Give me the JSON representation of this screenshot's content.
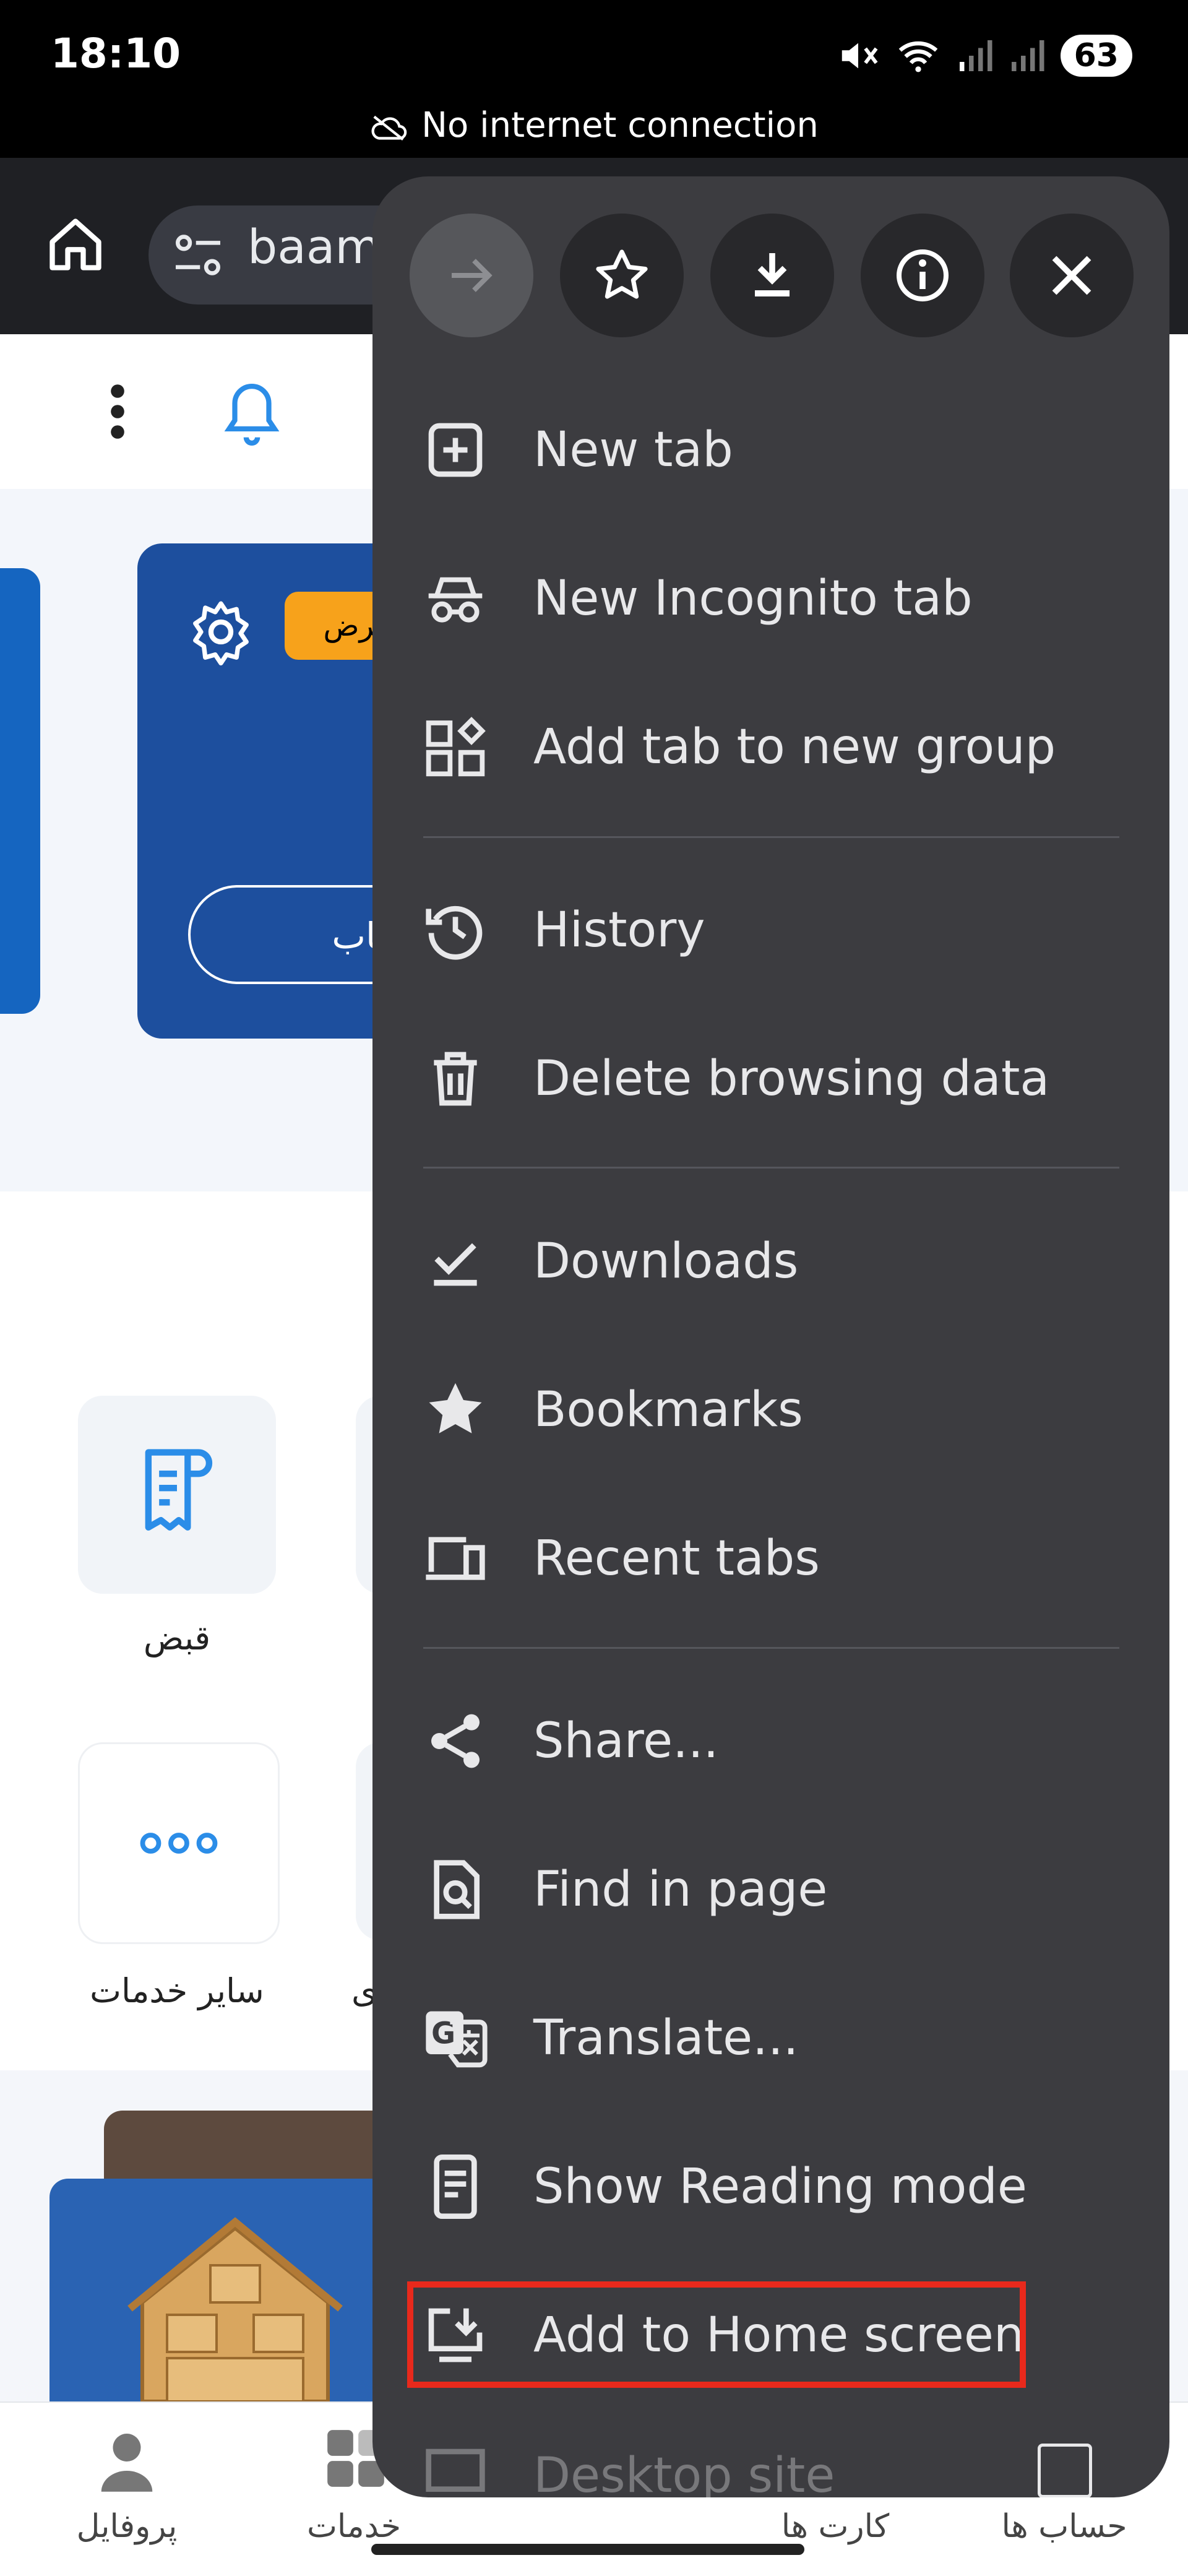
{
  "status_bar": {
    "time": "18:10",
    "battery": "63",
    "network_message": "No internet connection"
  },
  "browser": {
    "url_text": "baam",
    "toolbar_icons": [
      "forward-icon",
      "star-icon",
      "download-icon",
      "info-icon",
      "close-icon"
    ]
  },
  "page": {
    "card_badge": "فرض",
    "card_button": "ورتحساب",
    "services": [
      {
        "label": "قبض",
        "icon": "receipt-icon"
      },
      {
        "label": "سایر خدمات",
        "icon": "more-dots-icon"
      }
    ],
    "partial_label": "ى"
  },
  "bottom_nav": [
    {
      "label": "پروفایل",
      "icon": "profile-icon"
    },
    {
      "label": "خدمات",
      "icon": "services-icon"
    },
    {
      "label": "کارت ها",
      "icon": "cards-icon"
    },
    {
      "label": "حساب ها",
      "icon": "accounts-icon"
    }
  ],
  "menu": {
    "items": [
      {
        "label": "New tab",
        "icon": "new-tab-icon"
      },
      {
        "label": "New Incognito tab",
        "icon": "incognito-icon"
      },
      {
        "label": "Add tab to new group",
        "icon": "tab-group-icon"
      },
      {
        "label": "History",
        "icon": "history-icon"
      },
      {
        "label": "Delete browsing data",
        "icon": "trash-icon"
      },
      {
        "label": "Downloads",
        "icon": "downloads-icon"
      },
      {
        "label": "Bookmarks",
        "icon": "bookmarks-icon"
      },
      {
        "label": "Recent tabs",
        "icon": "recent-tabs-icon"
      },
      {
        "label": "Share...",
        "icon": "share-icon"
      },
      {
        "label": "Find in page",
        "icon": "find-in-page-icon"
      },
      {
        "label": "Translate...",
        "icon": "translate-icon"
      },
      {
        "label": "Show Reading mode",
        "icon": "reading-mode-icon"
      },
      {
        "label": "Add to Home screen",
        "icon": "add-to-home-icon"
      },
      {
        "label": "Desktop site",
        "icon": "desktop-site-icon"
      }
    ],
    "highlighted_item": "Add to Home screen"
  },
  "colors": {
    "menu_bg": "#3c3c40",
    "highlight": "#e8291c",
    "brand_blue": "#1d4f9e",
    "accent_orange": "#f7a21b"
  }
}
